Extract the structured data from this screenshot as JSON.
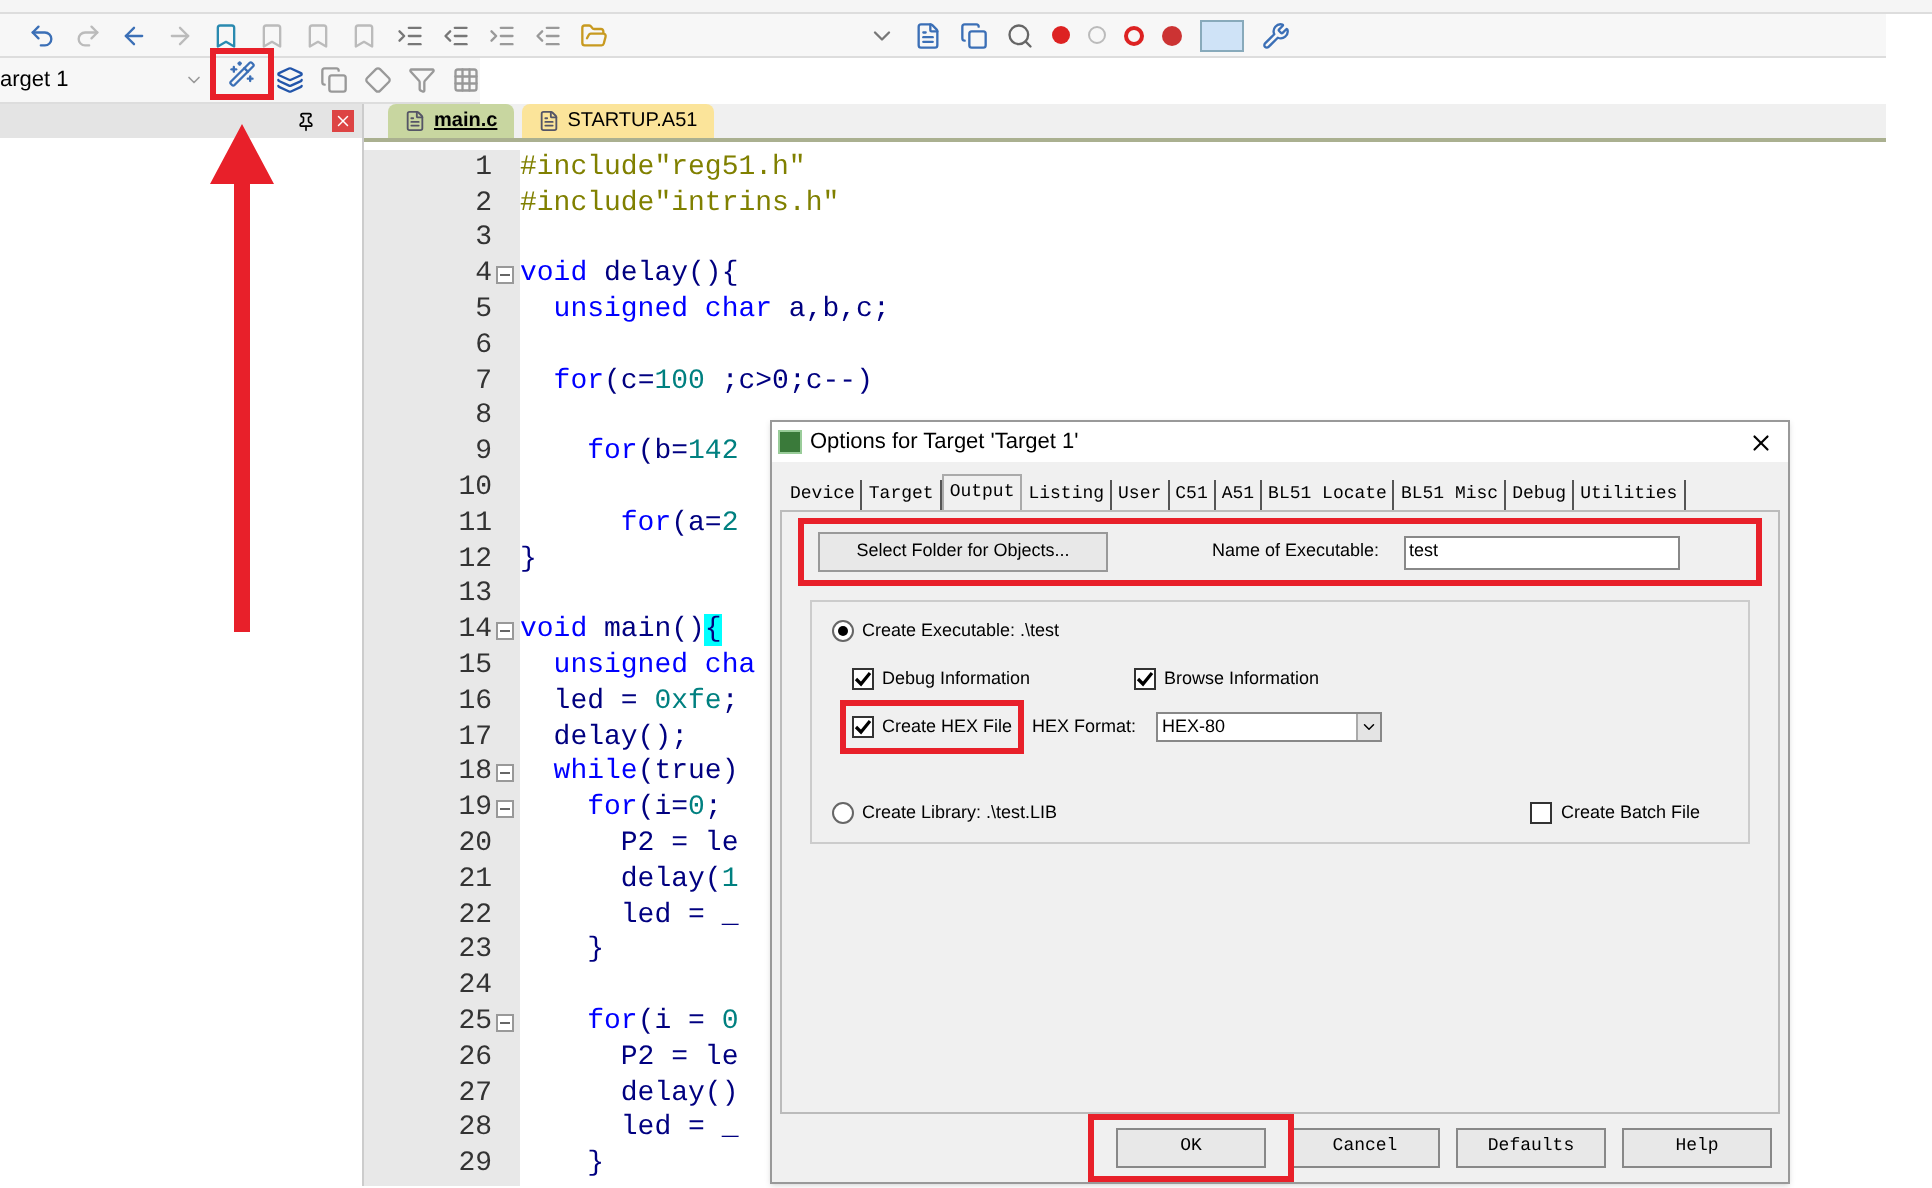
{
  "toolbar": {
    "target_select": "arget 1"
  },
  "editor": {
    "tabs": [
      {
        "label": "main.c",
        "selected": true
      },
      {
        "label": "STARTUP.A51",
        "selected": false
      }
    ],
    "lines": [
      {
        "number": "1",
        "fold": false,
        "tokens": [
          {
            "kind": "preproc",
            "text": "#include\"reg51.h\""
          }
        ]
      },
      {
        "number": "2",
        "fold": false,
        "tokens": [
          {
            "kind": "preproc",
            "text": "#include\"intrins.h\""
          }
        ]
      },
      {
        "number": "3",
        "fold": false
      },
      {
        "number": "4",
        "fold": true,
        "tokens": [
          {
            "kind": "keyword",
            "text": "void"
          },
          {
            "kind": "text",
            "text": " delay(){"
          }
        ]
      },
      {
        "number": "5",
        "fold": false,
        "tokens": [
          {
            "kind": "keyword",
            "text": "  unsigned char"
          },
          {
            "kind": "text",
            "text": " a,b,c;"
          }
        ]
      },
      {
        "number": "6",
        "fold": false
      },
      {
        "number": "7",
        "fold": false,
        "tokens": [
          {
            "kind": "keyword",
            "text": "  for"
          },
          {
            "kind": "text",
            "text": "(c="
          },
          {
            "kind": "number",
            "text": "100"
          },
          {
            "kind": "text",
            "text": " ;c>0;c--)"
          }
        ]
      },
      {
        "number": "8",
        "fold": false
      },
      {
        "number": "9",
        "fold": false,
        "tokens": [
          {
            "kind": "keyword",
            "text": "    for"
          },
          {
            "kind": "text",
            "text": "(b="
          },
          {
            "kind": "number",
            "text": "142"
          }
        ]
      },
      {
        "number": "10",
        "fold": false
      },
      {
        "number": "11",
        "fold": false,
        "tokens": [
          {
            "kind": "keyword",
            "text": "      for"
          },
          {
            "kind": "text",
            "text": "(a="
          },
          {
            "kind": "number",
            "text": "2"
          }
        ]
      },
      {
        "number": "12",
        "fold": false,
        "tokens": [
          {
            "kind": "text",
            "text": "}"
          }
        ]
      },
      {
        "number": "13",
        "fold": false
      },
      {
        "number": "14",
        "fold": true,
        "tokens": [
          {
            "kind": "keyword",
            "text": "void"
          },
          {
            "kind": "text",
            "text": " main()"
          },
          {
            "kind": "match",
            "text": "{"
          }
        ]
      },
      {
        "number": "15",
        "fold": false,
        "tokens": [
          {
            "kind": "keyword",
            "text": "  unsigned cha"
          }
        ]
      },
      {
        "number": "16",
        "fold": false,
        "tokens": [
          {
            "kind": "text",
            "text": "  led = "
          },
          {
            "kind": "number",
            "text": "0xfe"
          },
          {
            "kind": "text",
            "text": ";"
          }
        ]
      },
      {
        "number": "17",
        "fold": false,
        "tokens": [
          {
            "kind": "text",
            "text": "  delay();"
          }
        ]
      },
      {
        "number": "18",
        "fold": true,
        "tokens": [
          {
            "kind": "keyword",
            "text": "  while"
          },
          {
            "kind": "text",
            "text": "(true)"
          }
        ]
      },
      {
        "number": "19",
        "fold": true,
        "tokens": [
          {
            "kind": "keyword",
            "text": "    for"
          },
          {
            "kind": "text",
            "text": "(i="
          },
          {
            "kind": "number",
            "text": "0"
          },
          {
            "kind": "text",
            "text": ";"
          }
        ]
      },
      {
        "number": "20",
        "fold": false,
        "tokens": [
          {
            "kind": "text",
            "text": "      P2 = le"
          }
        ]
      },
      {
        "number": "21",
        "fold": false,
        "tokens": [
          {
            "kind": "text",
            "text": "      delay("
          },
          {
            "kind": "number",
            "text": "1"
          }
        ]
      },
      {
        "number": "22",
        "fold": false,
        "tokens": [
          {
            "kind": "text",
            "text": "      led = _"
          }
        ]
      },
      {
        "number": "23",
        "fold": false,
        "tokens": [
          {
            "kind": "text",
            "text": "    }"
          }
        ]
      },
      {
        "number": "24",
        "fold": false
      },
      {
        "number": "25",
        "fold": true,
        "tokens": [
          {
            "kind": "keyword",
            "text": "    for"
          },
          {
            "kind": "text",
            "text": "(i = "
          },
          {
            "kind": "number",
            "text": "0"
          }
        ]
      },
      {
        "number": "26",
        "fold": false,
        "tokens": [
          {
            "kind": "text",
            "text": "      P2 = le"
          }
        ]
      },
      {
        "number": "27",
        "fold": false,
        "tokens": [
          {
            "kind": "text",
            "text": "      delay()"
          }
        ]
      },
      {
        "number": "28",
        "fold": false,
        "tokens": [
          {
            "kind": "text",
            "text": "      led = _"
          }
        ]
      },
      {
        "number": "29",
        "fold": false,
        "tokens": [
          {
            "kind": "text",
            "text": "    }"
          }
        ]
      }
    ]
  },
  "dialog": {
    "title": "Options for Target 'Target 1'",
    "tabs": [
      {
        "label": "Device",
        "selected": false
      },
      {
        "label": "Target",
        "selected": false
      },
      {
        "label": "Output",
        "selected": true
      },
      {
        "label": "Listing",
        "selected": false
      },
      {
        "label": "User",
        "selected": false
      },
      {
        "label": "C51",
        "selected": false
      },
      {
        "label": "A51",
        "selected": false
      },
      {
        "label": "BL51 Locate",
        "selected": false
      },
      {
        "label": "BL51 Misc",
        "selected": false
      },
      {
        "label": "Debug",
        "selected": false
      },
      {
        "label": "Utilities",
        "selected": false
      }
    ],
    "select_folder_button": "Select Folder for Objects...",
    "name_label": "Name of Executable:",
    "name_value": "test",
    "create_executable": {
      "label": "Create Executable:  .\\test",
      "selected": true
    },
    "debug_info": {
      "label": "Debug Information",
      "checked": true
    },
    "browse_info": {
      "label": "Browse Information",
      "checked": true
    },
    "create_hex": {
      "label": "Create HEX File",
      "checked": true
    },
    "hex_format_label": "HEX Format:",
    "hex_format_value": "HEX-80",
    "create_library": {
      "label": "Create Library:  .\\test.LIB",
      "selected": false
    },
    "batch_file": {
      "label": "Create Batch File",
      "checked": false
    },
    "buttons": [
      "OK",
      "Cancel",
      "Defaults",
      "Help"
    ]
  }
}
